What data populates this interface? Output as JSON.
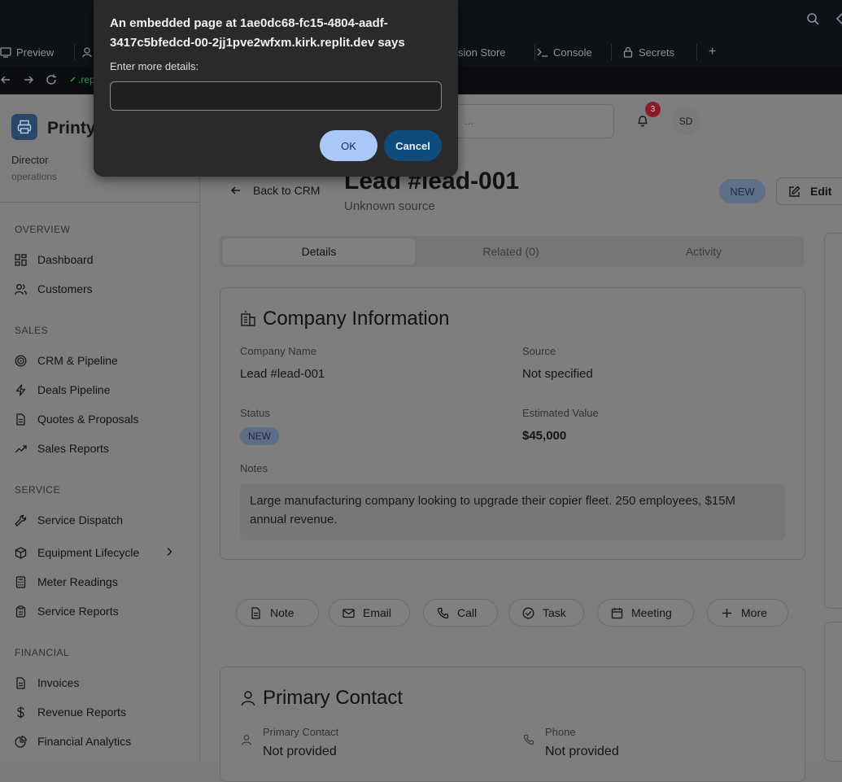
{
  "chrome": {
    "tabs": [
      {
        "label": "Preview"
      },
      {
        "label": "sion Store"
      },
      {
        "label": "Console"
      },
      {
        "label": "Secrets"
      }
    ],
    "new_tab": "+",
    "url": ".rep"
  },
  "sidebar": {
    "brand": "Printy",
    "user_role": "Director",
    "user_dept": "operations",
    "sections": {
      "overview": "OVERVIEW",
      "sales": "SALES",
      "service": "SERVICE",
      "financial": "FINANCIAL"
    },
    "items": {
      "dashboard": "Dashboard",
      "customers": "Customers",
      "crm": "CRM & Pipeline",
      "deals": "Deals Pipeline",
      "quotes": "Quotes & Proposals",
      "sales_reports": "Sales Reports",
      "dispatch": "Service Dispatch",
      "equipment": "Equipment Lifecycle",
      "meter": "Meter Readings",
      "service_reports": "Service Reports",
      "invoices": "Invoices",
      "revenue": "Revenue Reports",
      "analytics": "Financial Analytics"
    }
  },
  "header": {
    "search_placeholder": "...",
    "notification_count": "3",
    "avatar_initials": "SD"
  },
  "lead": {
    "back_label": "Back to CRM",
    "title": "Lead #lead-001",
    "subtitle": "Unknown source",
    "status_badge": "NEW",
    "edit_label": "Edit"
  },
  "tabs": {
    "details": "Details",
    "related": "Related (0)",
    "activity": "Activity"
  },
  "company_card": {
    "title": "Company Information",
    "company_name_label": "Company Name",
    "company_name": "Lead #lead-001",
    "source_label": "Source",
    "source": "Not specified",
    "status_label": "Status",
    "status": "NEW",
    "estimated_value_label": "Estimated Value",
    "estimated_value": "$45,000",
    "notes_label": "Notes",
    "notes": "Large manufacturing company looking to upgrade their copier fleet. 250 employees, $15M annual revenue."
  },
  "actions": {
    "note": "Note",
    "email": "Email",
    "call": "Call",
    "task": "Task",
    "meeting": "Meeting",
    "more": "More"
  },
  "contact_card": {
    "title": "Primary Contact",
    "contact_label": "Primary Contact",
    "contact_value": "Not provided",
    "phone_label": "Phone",
    "phone_value": "Not provided"
  },
  "dialog": {
    "message": "An embedded page at 1ae0dc68-fc15-4804-aadf-3417c5bfedcd-00-2jj1pve2wfxm.kirk.replit.dev says",
    "prompt": "Enter more details:",
    "input_value": "",
    "ok_label": "OK",
    "cancel_label": "Cancel"
  }
}
